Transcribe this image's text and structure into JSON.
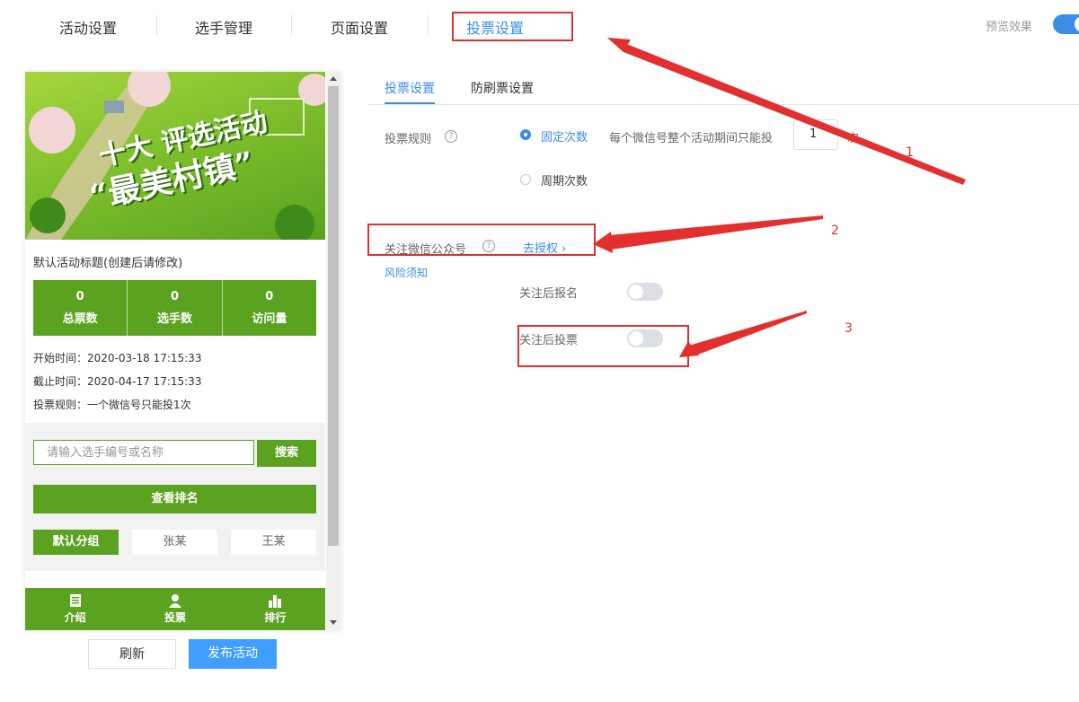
{
  "top_tabs": [
    "活动设置",
    "选手管理",
    "页面设置",
    "投票设置"
  ],
  "preview_label": "预览效果",
  "phone": {
    "banner_line1": "十大 评选活动",
    "banner_line2": "“最美村镇”",
    "activity_title": "默认活动标题(创建后请修改)",
    "stats": [
      {
        "value": "0",
        "label": "总票数"
      },
      {
        "value": "0",
        "label": "选手数"
      },
      {
        "value": "0",
        "label": "访问量"
      }
    ],
    "start_time": "开始时间：2020-03-18 17:15:33",
    "end_time": "截止时间：2020-04-17 17:15:33",
    "vote_rule": "投票规则：一个微信号只能投1次",
    "search_placeholder": "请输入选手编号或名称",
    "search_button": "搜索",
    "rank_button": "查看排名",
    "groups": [
      "默认分组",
      "张某",
      "王某"
    ],
    "nav": [
      "介绍",
      "投票",
      "排行"
    ]
  },
  "buttons": {
    "refresh": "刷新",
    "publish": "发布活动"
  },
  "sub_tabs": [
    "投票设置",
    "防刷票设置"
  ],
  "form": {
    "vote_rule_label": "投票规则",
    "fixed_count": "固定次数",
    "per_wechat_text": "每个微信号整个活动期间只能投",
    "count_value": "1",
    "count_unit": "次",
    "periodic_count": "周期次数",
    "follow_label": "关注微信公众号",
    "authorize_link": "去授权 ›",
    "risk_link": "风险须知",
    "follow_to_register": "关注后报名",
    "follow_to_vote": "关注后投票"
  },
  "annotations": [
    "1",
    "2",
    "3"
  ],
  "colors": {
    "accent": "#3a8ee6",
    "green": "#5aa21f",
    "annotation": "#e3302f"
  }
}
